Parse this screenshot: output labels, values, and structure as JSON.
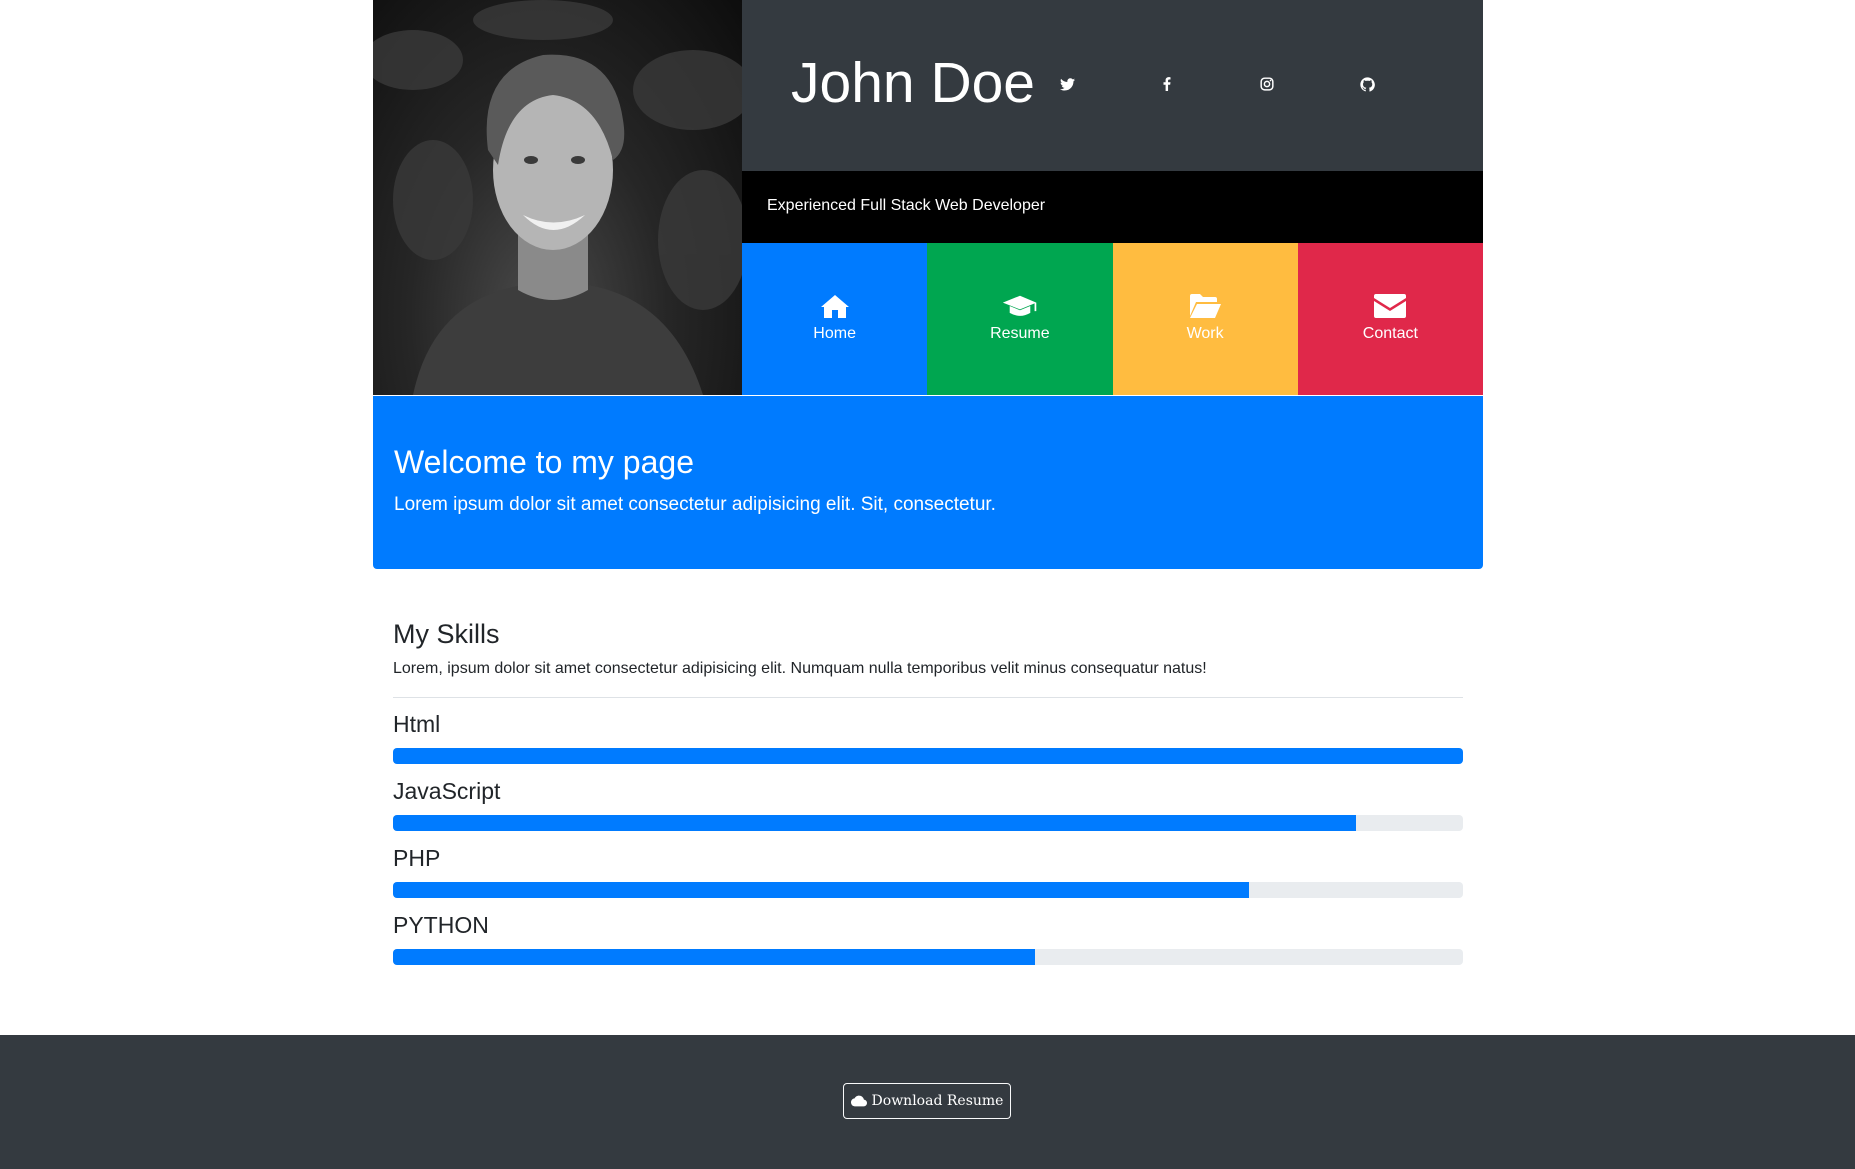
{
  "header": {
    "name": "John Doe",
    "subtitle": "Experienced Full Stack Web Developer",
    "social": [
      {
        "icon": "twitter-icon"
      },
      {
        "icon": "facebook-icon"
      },
      {
        "icon": "instagram-icon"
      },
      {
        "icon": "github-icon"
      }
    ]
  },
  "nav": [
    {
      "label": "Home",
      "icon": "home-icon",
      "color": "#007bff"
    },
    {
      "label": "Resume",
      "icon": "graduation-cap-icon",
      "color": "#00a650"
    },
    {
      "label": "Work",
      "icon": "folder-open-icon",
      "color": "#ffbc40"
    },
    {
      "label": "Contact",
      "icon": "envelope-icon",
      "color": "#e0284a"
    }
  ],
  "welcome": {
    "title": "Welcome to my page",
    "text": "Lorem ipsum dolor sit amet consectetur adipisicing elit. Sit, consectetur.",
    "color": "#007bff"
  },
  "skills": {
    "title": "My Skills",
    "intro": "Lorem, ipsum dolor sit amet consectetur adipisicing elit. Numquam nulla temporibus velit minus consequatur natus!",
    "bar_color": "#007bff",
    "items": [
      {
        "name": "Html",
        "percent": 100
      },
      {
        "name": "JavaScript",
        "percent": 90
      },
      {
        "name": "PHP",
        "percent": 80
      },
      {
        "name": "PYTHON",
        "percent": 60
      }
    ]
  },
  "footer": {
    "download_label": "Download Resume",
    "download_icon": "cloud-icon"
  }
}
